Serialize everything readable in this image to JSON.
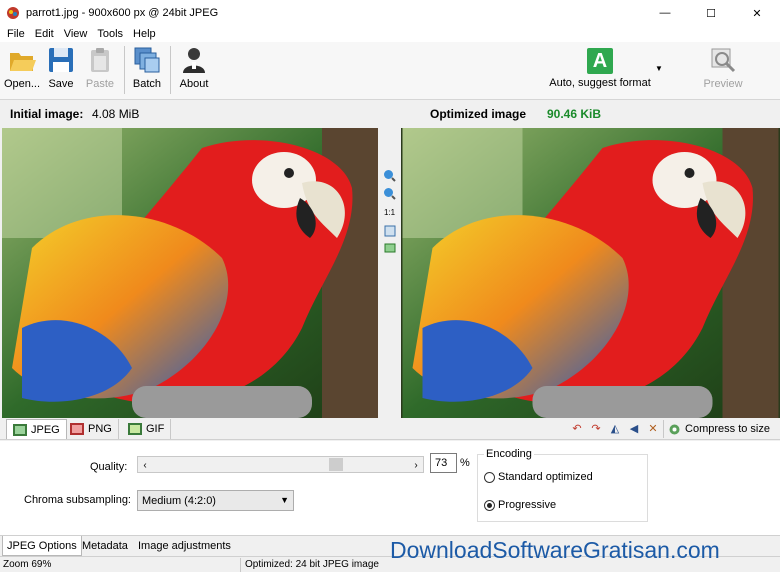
{
  "window": {
    "title": "parrot1.jpg - 900x600 px @ 24bit JPEG",
    "controls": [
      "—",
      "☐",
      "✕"
    ]
  },
  "menu": [
    "File",
    "Edit",
    "View",
    "Tools",
    "Help"
  ],
  "toolbar": {
    "open": "Open...",
    "save": "Save",
    "paste": "Paste",
    "batch": "Batch",
    "about": "About",
    "format_label": "Auto, suggest format",
    "format_badge": "A",
    "preview": "Preview"
  },
  "info": {
    "initial_label": "Initial image:",
    "initial_value": "4.08 MiB",
    "optimized_label": "Optimized image",
    "optimized_value": "90.46 KiB",
    "optimized_color": "#1a8a2a"
  },
  "zoom": {
    "zoom_in": "+",
    "zoom_out": "−",
    "actual_size": "1:1",
    "fit": "▢",
    "swap": "⇄"
  },
  "format_tabs": [
    "JPEG",
    "PNG",
    "GIF"
  ],
  "tools": [
    "↶",
    "↷",
    "◭",
    "◀",
    "✕"
  ],
  "compress_label": "Compress to size",
  "jpeg_options": {
    "quality_label": "Quality:",
    "quality_value": "73",
    "quality_percent": 73,
    "quality_unit": "%",
    "chroma_label": "Chroma subsampling:",
    "chroma_value": "Medium (4:2:0)",
    "encoding_legend": "Encoding",
    "encoding_options": [
      "Standard optimized",
      "Progressive"
    ],
    "encoding_selected": "Progressive"
  },
  "bottom_tabs": [
    "JPEG Options",
    "Metadata",
    "Image adjustments"
  ],
  "status": {
    "zoom": "Zoom 69%",
    "message": "Optimized: 24 bit JPEG image"
  },
  "watermark": "DownloadSoftwareGratisan.com"
}
